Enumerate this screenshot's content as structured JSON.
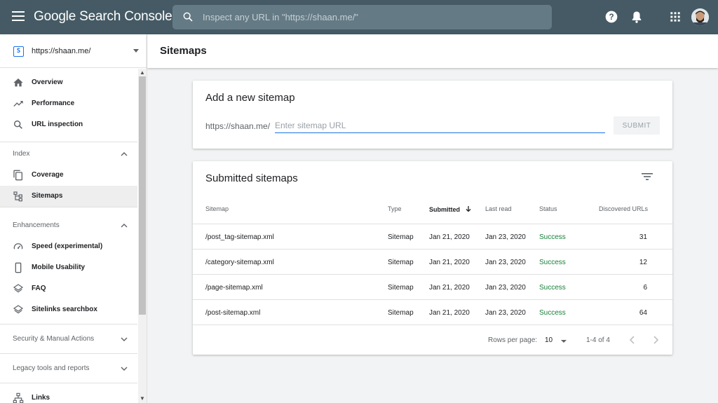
{
  "app": {
    "title": "Google Search Console",
    "search_placeholder": "Inspect any URL in \"https://shaan.me/\""
  },
  "header_icons": [
    "help-icon",
    "notifications-icon",
    "apps-icon",
    "account-avatar"
  ],
  "sidebar": {
    "property": "https://shaan.me/",
    "property_favicon": "[S]",
    "items": [
      {
        "label": "Overview",
        "icon": "home-icon"
      },
      {
        "label": "Performance",
        "icon": "trending-up-icon"
      },
      {
        "label": "URL inspection",
        "icon": "search-icon"
      }
    ],
    "sections": {
      "index": {
        "label": "Index",
        "items": [
          {
            "label": "Coverage",
            "icon": "copy-icon"
          },
          {
            "label": "Sitemaps",
            "icon": "sitemap-icon",
            "active": true
          }
        ]
      },
      "enhancements": {
        "label": "Enhancements",
        "items": [
          {
            "label": "Speed (experimental)",
            "icon": "speedometer-icon"
          },
          {
            "label": "Mobile Usability",
            "icon": "phone-icon"
          },
          {
            "label": "FAQ",
            "icon": "layers-icon"
          },
          {
            "label": "Sitelinks searchbox",
            "icon": "layers-icon"
          }
        ]
      },
      "security": {
        "label": "Security & Manual Actions"
      },
      "legacy": {
        "label": "Legacy tools and reports"
      },
      "links": {
        "label": "Links",
        "icon": "links-icon"
      }
    }
  },
  "page": {
    "title": "Sitemaps"
  },
  "add_sitemap": {
    "title": "Add a new sitemap",
    "prefix": "https://shaan.me/",
    "placeholder": "Enter sitemap URL",
    "submit_label": "SUBMIT"
  },
  "submitted": {
    "title": "Submitted sitemaps",
    "columns": {
      "sitemap": "Sitemap",
      "type": "Type",
      "submitted": "Submitted",
      "last_read": "Last read",
      "status": "Status",
      "discovered": "Discovered URLs"
    },
    "rows": [
      {
        "sitemap": "/post_tag-sitemap.xml",
        "type": "Sitemap",
        "submitted": "Jan 21, 2020",
        "last_read": "Jan 23, 2020",
        "status": "Success",
        "discovered": "31"
      },
      {
        "sitemap": "/category-sitemap.xml",
        "type": "Sitemap",
        "submitted": "Jan 21, 2020",
        "last_read": "Jan 23, 2020",
        "status": "Success",
        "discovered": "12"
      },
      {
        "sitemap": "/page-sitemap.xml",
        "type": "Sitemap",
        "submitted": "Jan 21, 2020",
        "last_read": "Jan 23, 2020",
        "status": "Success",
        "discovered": "6"
      },
      {
        "sitemap": "/post-sitemap.xml",
        "type": "Sitemap",
        "submitted": "Jan 21, 2020",
        "last_read": "Jan 23, 2020",
        "status": "Success",
        "discovered": "64"
      }
    ],
    "pagination": {
      "rows_per_page_label": "Rows per page:",
      "rows_per_page": "10",
      "range": "1-4 of 4"
    }
  },
  "colors": {
    "topbar": "#455a64",
    "accent": "#1a73e8",
    "success": "#188038"
  }
}
